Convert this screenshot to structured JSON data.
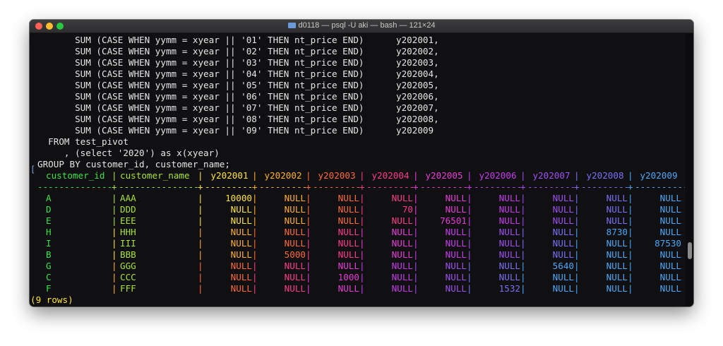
{
  "window": {
    "title": "d0118 — psql -U aki — bash — 121×24"
  },
  "sql_lines": [
    "       SUM (CASE WHEN yymm = xyear || '01' THEN nt_price END)      y202001,",
    "       SUM (CASE WHEN yymm = xyear || '02' THEN nt_price END)      y202002,",
    "       SUM (CASE WHEN yymm = xyear || '03' THEN nt_price END)      y202003,",
    "       SUM (CASE WHEN yymm = xyear || '04' THEN nt_price END)      y202004,",
    "       SUM (CASE WHEN yymm = xyear || '05' THEN nt_price END)      y202005,",
    "       SUM (CASE WHEN yymm = xyear || '06' THEN nt_price END)      y202006,",
    "       SUM (CASE WHEN yymm = xyear || '07' THEN nt_price END)      y202007,",
    "       SUM (CASE WHEN yymm = xyear || '08' THEN nt_price END)      y202008,",
    "       SUM (CASE WHEN yymm = xyear || '09' THEN nt_price END)      y202009",
    "  FROM test_pivot",
    "     , (select '2020') as x(xyear)",
    "GROUP BY customer_id, customer_name;"
  ],
  "table": {
    "headers": [
      "customer_id",
      "customer_name",
      "y202001",
      "y202002",
      "y202003",
      "y202004",
      "y202005",
      "y202006",
      "y202007",
      "y202008",
      "y202009"
    ],
    "rows": [
      [
        "A",
        "AAA",
        "10000",
        "NULL",
        "NULL",
        "NULL",
        "NULL",
        "NULL",
        "NULL",
        "NULL",
        "NULL"
      ],
      [
        "D",
        "DDD",
        "NULL",
        "NULL",
        "NULL",
        "70",
        "NULL",
        "NULL",
        "NULL",
        "NULL",
        "NULL"
      ],
      [
        "E",
        "EEE",
        "NULL",
        "NULL",
        "NULL",
        "NULL",
        "76501",
        "NULL",
        "NULL",
        "NULL",
        "NULL"
      ],
      [
        "H",
        "HHH",
        "NULL",
        "NULL",
        "NULL",
        "NULL",
        "NULL",
        "NULL",
        "NULL",
        "8730",
        "NULL"
      ],
      [
        "I",
        "III",
        "NULL",
        "NULL",
        "NULL",
        "NULL",
        "NULL",
        "NULL",
        "NULL",
        "NULL",
        "87530"
      ],
      [
        "B",
        "BBB",
        "NULL",
        "5000",
        "NULL",
        "NULL",
        "NULL",
        "NULL",
        "NULL",
        "NULL",
        "NULL"
      ],
      [
        "G",
        "GGG",
        "NULL",
        "NULL",
        "NULL",
        "NULL",
        "NULL",
        "NULL",
        "5640",
        "NULL",
        "NULL"
      ],
      [
        "C",
        "CCC",
        "NULL",
        "NULL",
        "1000",
        "NULL",
        "NULL",
        "NULL",
        "NULL",
        "NULL",
        "NULL"
      ],
      [
        "F",
        "FFF",
        "NULL",
        "NULL",
        "NULL",
        "NULL",
        "NULL",
        "1532",
        "NULL",
        "NULL",
        "NULL"
      ]
    ],
    "footer": "(9 rows)"
  },
  "colors": {
    "text": "#e6e6e6",
    "rainbow": [
      "#3ee24a",
      "#a8e23a",
      "#ffe23a",
      "#ffb02a",
      "#ff6a3a",
      "#ff3a8c",
      "#ea3ad8",
      "#c83aee",
      "#a04ef0",
      "#7a70f4",
      "#4aa8f8"
    ],
    "footer": "#ffe23a"
  }
}
